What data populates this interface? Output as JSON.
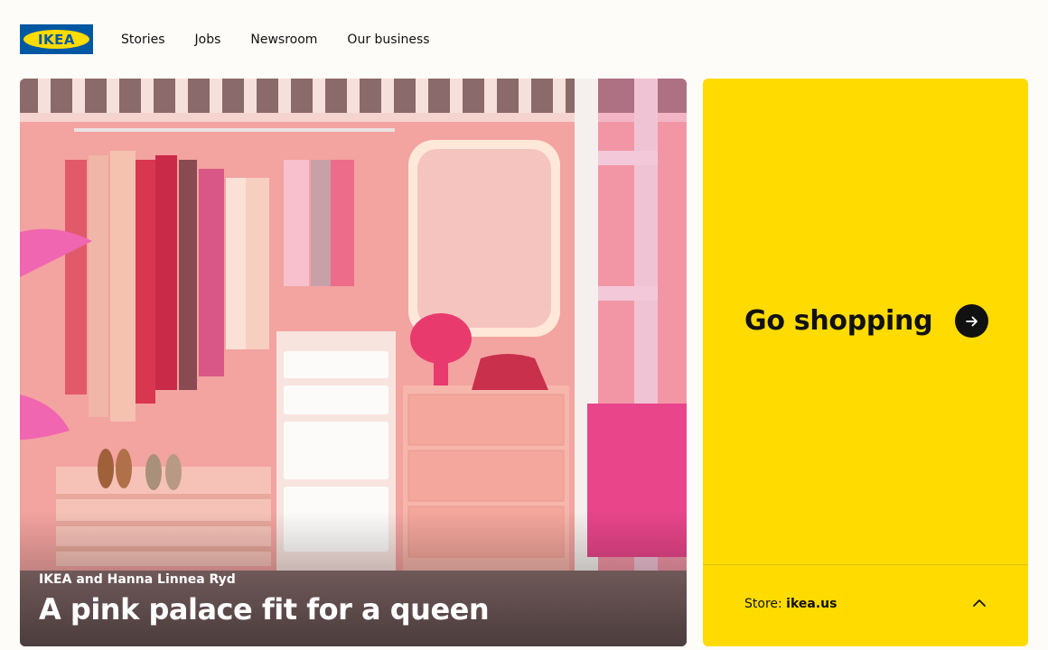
{
  "brand": {
    "logo_text": "IKEA",
    "blue": "#0058a3",
    "yellow": "#ffdb00"
  },
  "nav": {
    "items": [
      {
        "label": "Stories"
      },
      {
        "label": "Jobs"
      },
      {
        "label": "Newsroom"
      },
      {
        "label": "Our business"
      }
    ]
  },
  "hero": {
    "kicker": "IKEA and Hanna Linnea Ryd",
    "title": "A pink palace fit for a queen",
    "image_alt": "pink-bedroom-closet-photo"
  },
  "shop_card": {
    "title": "Go shopping",
    "arrow_icon": "arrow-right-icon",
    "store_label": "Store: ",
    "store_name": "ikea.us",
    "toggle_icon": "chevron-up-icon"
  }
}
